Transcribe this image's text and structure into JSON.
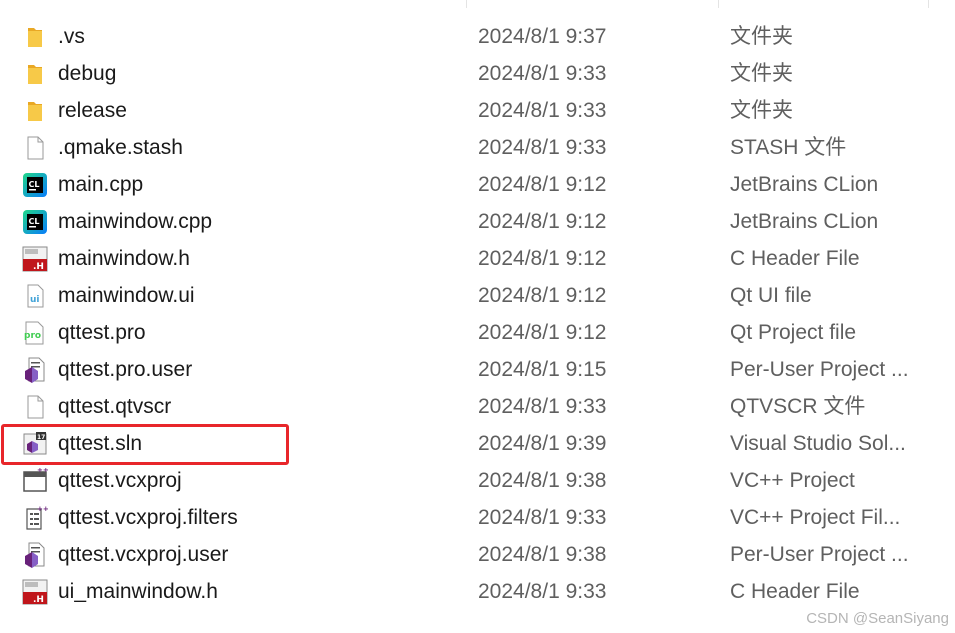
{
  "files": [
    {
      "name": ".vs",
      "date": "2024/8/1 9:37",
      "type": "文件夹",
      "icon": "folder-icon"
    },
    {
      "name": "debug",
      "date": "2024/8/1 9:33",
      "type": "文件夹",
      "icon": "folder-icon"
    },
    {
      "name": "release",
      "date": "2024/8/1 9:33",
      "type": "文件夹",
      "icon": "folder-icon"
    },
    {
      "name": ".qmake.stash",
      "date": "2024/8/1 9:33",
      "type": "STASH 文件",
      "icon": "blank-file-icon"
    },
    {
      "name": "main.cpp",
      "date": "2024/8/1 9:12",
      "type": "JetBrains CLion",
      "icon": "clion-icon"
    },
    {
      "name": "mainwindow.cpp",
      "date": "2024/8/1 9:12",
      "type": "JetBrains CLion",
      "icon": "clion-icon"
    },
    {
      "name": "mainwindow.h",
      "date": "2024/8/1 9:12",
      "type": "C Header File",
      "icon": "header-file-icon"
    },
    {
      "name": "mainwindow.ui",
      "date": "2024/8/1 9:12",
      "type": "Qt UI file",
      "icon": "qt-ui-file-icon"
    },
    {
      "name": "qttest.pro",
      "date": "2024/8/1 9:12",
      "type": "Qt Project file",
      "icon": "qt-pro-file-icon"
    },
    {
      "name": "qttest.pro.user",
      "date": "2024/8/1 9:15",
      "type": "Per-User Project ...",
      "icon": "vs-user-file-icon"
    },
    {
      "name": "qttest.qtvscr",
      "date": "2024/8/1 9:33",
      "type": "QTVSCR 文件",
      "icon": "blank-file-icon"
    },
    {
      "name": "qttest.sln",
      "date": "2024/8/1 9:39",
      "type": "Visual Studio Sol...",
      "icon": "visual-studio-solution-icon"
    },
    {
      "name": "qttest.vcxproj",
      "date": "2024/8/1 9:38",
      "type": "VC++ Project",
      "icon": "vcxproj-icon"
    },
    {
      "name": "qttest.vcxproj.filters",
      "date": "2024/8/1 9:33",
      "type": "VC++ Project Fil...",
      "icon": "vcxproj-filters-icon"
    },
    {
      "name": "qttest.vcxproj.user",
      "date": "2024/8/1 9:38",
      "type": "Per-User Project ...",
      "icon": "vs-user-file-icon"
    },
    {
      "name": "ui_mainwindow.h",
      "date": "2024/8/1 9:33",
      "type": "C Header File",
      "icon": "header-file-icon"
    }
  ],
  "watermark": "CSDN @SeanSiyang",
  "colors": {
    "highlight": "#e8262a",
    "folder": "#f3c04a",
    "clion": "#21d789",
    "vs_purple": "#68217a"
  }
}
